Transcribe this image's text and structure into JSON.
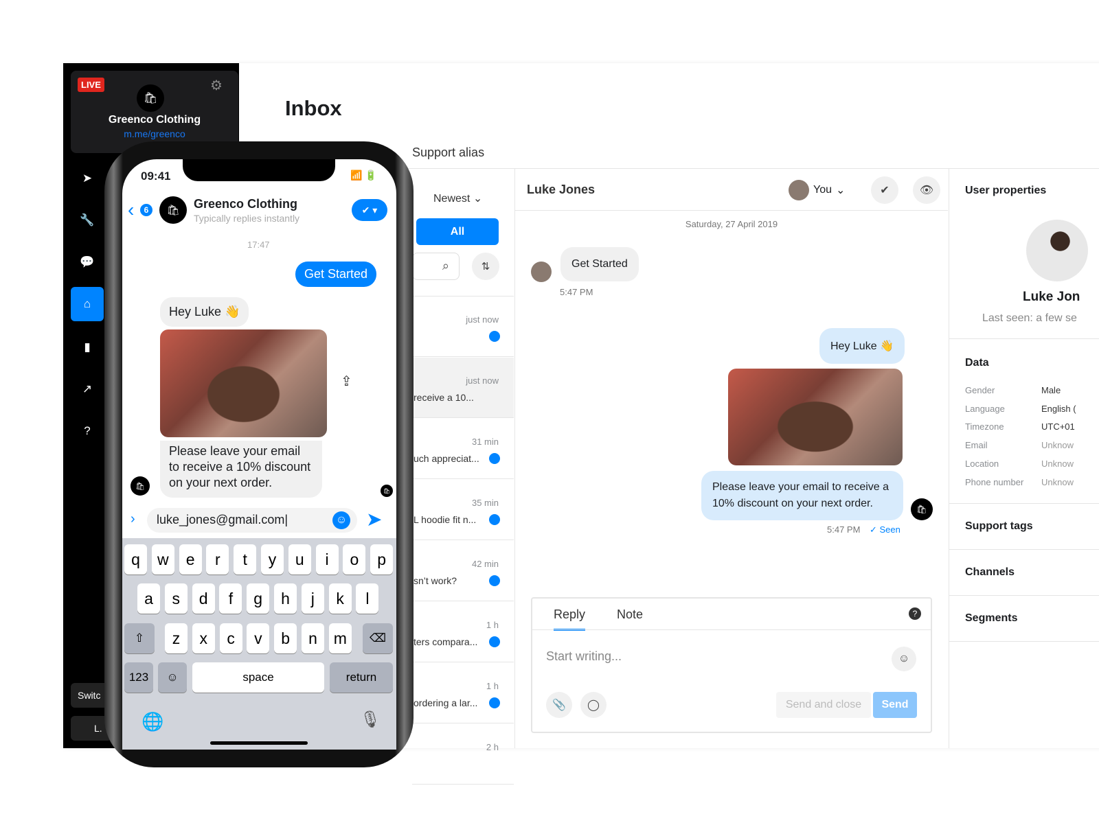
{
  "sidebar": {
    "live_badge": "LIVE",
    "page_name": "Greenco Clothing",
    "page_link": "m.me/greenco",
    "switch_label": "Switc",
    "user_label": "L.",
    "icons": [
      "send-icon",
      "wrench-icon",
      "chat-icon",
      "inbox-icon",
      "bar-chart-icon",
      "trend-icon",
      "help-icon"
    ]
  },
  "header": {
    "title": "Inbox",
    "tab": "Support alias"
  },
  "list": {
    "sort": "Newest",
    "filter": "All",
    "items": [
      {
        "time": "just now",
        "preview": "",
        "unread": true
      },
      {
        "time": "just now",
        "preview": "receive a 10...",
        "unread": false
      },
      {
        "time": "31 min",
        "preview": "uch appreciat...",
        "unread": true
      },
      {
        "time": "35 min",
        "preview": "L hoodie fit n...",
        "unread": true
      },
      {
        "time": "42 min",
        "preview": "sn’t work?",
        "unread": true
      },
      {
        "time": "1 h",
        "preview": "ters compara...",
        "unread": true
      },
      {
        "time": "1 h",
        "preview": "ordering a lar...",
        "unread": true
      },
      {
        "time": "2 h",
        "preview": "",
        "unread": false
      }
    ]
  },
  "chat": {
    "contact": "Luke Jones",
    "assignee": "You",
    "date": "Saturday, 27 April 2019",
    "msg1": "Get Started",
    "msg1_time": "5:47 PM",
    "msg2": "Hey Luke 👋",
    "msg3": "Please leave your email to receive a 10% discount on your next order.",
    "msg3_time": "5:47 PM",
    "seen": "Seen",
    "composer": {
      "tab_reply": "Reply",
      "tab_note": "Note",
      "placeholder": "Start writing...",
      "send_close": "Send and close",
      "send": "Send"
    }
  },
  "profile": {
    "title": "User properties",
    "name": "Luke Jon",
    "last_seen": "Last seen: a few se",
    "data_title": "Data",
    "fields": [
      {
        "k": "Gender",
        "v": "Male"
      },
      {
        "k": "Language",
        "v": "English ("
      },
      {
        "k": "Timezone",
        "v": "UTC+01"
      },
      {
        "k": "Email",
        "v": "Unknow"
      },
      {
        "k": "Location",
        "v": "Unknow"
      },
      {
        "k": "Phone number",
        "v": "Unknow"
      }
    ],
    "sections": [
      "Support tags",
      "Channels",
      "Segments"
    ]
  },
  "phone": {
    "time": "09:41",
    "back_count": "6",
    "page_name": "Greenco Clothing",
    "subtitle": "Typically replies instantly",
    "timestamp": "17:47",
    "msg1": "Get Started",
    "msg2": "Hey Luke 👋",
    "msg3": "Please leave your email to receive a 10% discount on your next order.",
    "input": "luke_jones@gmail.com",
    "keys": {
      "row1": [
        "q",
        "w",
        "e",
        "r",
        "t",
        "y",
        "u",
        "i",
        "o",
        "p"
      ],
      "row2": [
        "a",
        "s",
        "d",
        "f",
        "g",
        "h",
        "j",
        "k",
        "l"
      ],
      "row3": [
        "z",
        "x",
        "c",
        "v",
        "b",
        "n",
        "m"
      ],
      "num": "123",
      "space": "space",
      "return": "return"
    }
  },
  "colors": {
    "accent": "#0084ff",
    "live": "#e0261e",
    "sidebar": "#000000"
  }
}
